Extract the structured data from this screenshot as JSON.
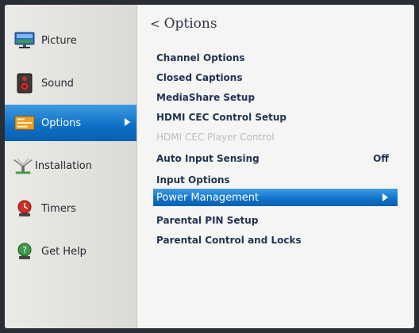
{
  "sidebar": {
    "items": [
      {
        "label": "Picture",
        "icon": "picture-icon"
      },
      {
        "label": "Sound",
        "icon": "speaker-icon"
      },
      {
        "label": "Options",
        "icon": "options-icon",
        "active": true
      },
      {
        "label": "Installation",
        "icon": "installation-icon"
      },
      {
        "label": "Timers",
        "icon": "timer-icon"
      },
      {
        "label": "Get Help",
        "icon": "help-icon"
      }
    ]
  },
  "main": {
    "back_icon": "<",
    "title": "Options",
    "items": [
      {
        "label": "Channel Options"
      },
      {
        "label": "Closed Captions"
      },
      {
        "label": "MediaShare Setup"
      },
      {
        "label": "HDMI CEC Control Setup"
      },
      {
        "label": "HDMI CEC Player Control",
        "disabled": true
      },
      {
        "label": "Auto Input Sensing",
        "value": "Off"
      },
      {
        "label": "Input Options"
      },
      {
        "label": "Power Management",
        "selected": true
      },
      {
        "label": "Parental PIN Setup"
      },
      {
        "label": "Parental Control and Locks"
      }
    ]
  },
  "colors": {
    "accent_blue": "#0e70c7",
    "screen_bg": "#f4f4f3",
    "frame": "#2a2d33"
  }
}
